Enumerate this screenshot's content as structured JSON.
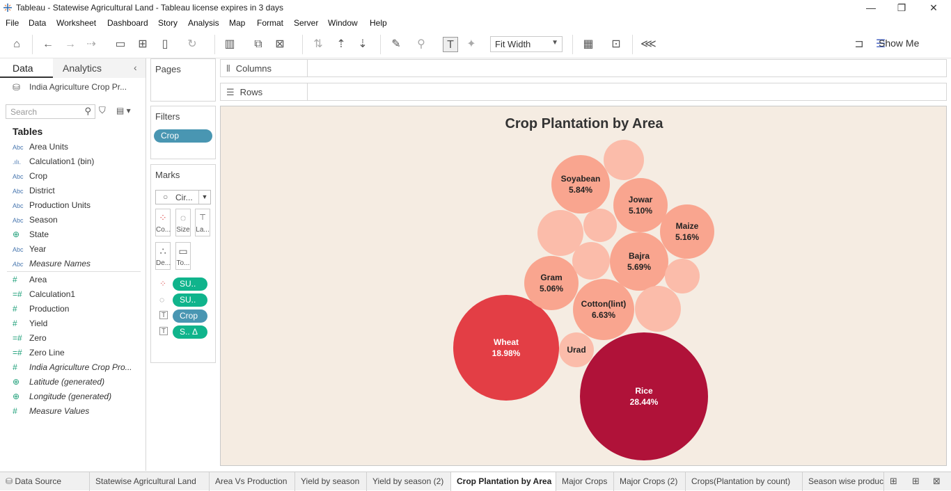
{
  "window": {
    "title": "Tableau - Statewise Agricultural Land - Tableau license expires in 3 days",
    "buttons": [
      "—",
      "❐",
      "✕"
    ]
  },
  "menu": [
    "File",
    "Data",
    "Worksheet",
    "Dashboard",
    "Story",
    "Analysis",
    "Map",
    "Format",
    "Server",
    "Window",
    "Help"
  ],
  "toolbar": {
    "fit": "Fit Width",
    "show_me": "Show Me"
  },
  "datapane": {
    "tabs": [
      "Data",
      "Analytics"
    ],
    "datasource": "India Agriculture Crop Pr...",
    "search_placeholder": "Search",
    "tables_heading": "Tables",
    "dimensions": [
      {
        "icon": "Abc",
        "type": "text",
        "name": "Area Units"
      },
      {
        "icon": ".ılı.",
        "type": "bin",
        "name": "Calculation1 (bin)"
      },
      {
        "icon": "Abc",
        "type": "text",
        "name": "Crop"
      },
      {
        "icon": "Abc",
        "type": "text",
        "name": "District"
      },
      {
        "icon": "Abc",
        "type": "text",
        "name": "Production Units"
      },
      {
        "icon": "Abc",
        "type": "text",
        "name": "Season"
      },
      {
        "icon": "⊕",
        "type": "geo",
        "name": "State"
      },
      {
        "icon": "Abc",
        "type": "text",
        "name": "Year"
      },
      {
        "icon": "Abc",
        "type": "text",
        "name": "Measure Names",
        "italic": true
      }
    ],
    "measures": [
      {
        "icon": "#",
        "name": "Area"
      },
      {
        "icon": "=#",
        "name": "Calculation1"
      },
      {
        "icon": "#",
        "name": "Production"
      },
      {
        "icon": "#",
        "name": "Yield"
      },
      {
        "icon": "=#",
        "name": "Zero"
      },
      {
        "icon": "=#",
        "name": "Zero Line"
      },
      {
        "icon": "#",
        "name": "India Agriculture Crop Pro...",
        "italic": true
      },
      {
        "icon": "⊕",
        "name": "Latitude (generated)",
        "italic": true
      },
      {
        "icon": "⊕",
        "name": "Longitude (generated)",
        "italic": true
      },
      {
        "icon": "#",
        "name": "Measure Values",
        "italic": true
      }
    ]
  },
  "cards": {
    "pages": "Pages",
    "filters": "Filters",
    "filter_pill": "Crop",
    "marks": "Marks",
    "mark_type": "Cir...",
    "mark_buttons": [
      "Co...",
      "Size",
      "La...",
      "De...",
      "To..."
    ],
    "mark_pills": [
      "SU..",
      "SU..",
      "Crop",
      "S.. Δ"
    ]
  },
  "shelves": {
    "columns": "Columns",
    "rows": "Rows"
  },
  "chart_data": {
    "type": "packed-bubble",
    "title": "Crop Plantation by Area",
    "bubbles": [
      {
        "label": "Rice",
        "value": "28.44%"
      },
      {
        "label": "Wheat",
        "value": "18.98%"
      },
      {
        "label": "Cotton(lint)",
        "value": "6.63%"
      },
      {
        "label": "Soyabean",
        "value": "5.84%"
      },
      {
        "label": "Bajra",
        "value": "5.69%"
      },
      {
        "label": "Maize",
        "value": "5.16%"
      },
      {
        "label": "Jowar",
        "value": "5.10%"
      },
      {
        "label": "Gram",
        "value": "5.06%"
      },
      {
        "label": "Urad",
        "value": ""
      },
      {
        "label": "",
        "value": ""
      },
      {
        "label": "",
        "value": ""
      },
      {
        "label": "",
        "value": ""
      },
      {
        "label": "",
        "value": ""
      },
      {
        "label": "",
        "value": ""
      },
      {
        "label": "",
        "value": ""
      }
    ],
    "colors": {
      "high": "#b01239",
      "mid": "#e33e45",
      "low": "#f9a58f",
      "faint": "#fbbcaa"
    }
  },
  "sheet_tabs": [
    "Data Source",
    "Statewise Agricultural Land",
    "Area Vs Production",
    "Yield by season",
    "Yield by season (2)",
    "Crop Plantation by Area",
    "Major Crops",
    "Major Crops (2)",
    "Crops(Plantation by count)",
    "Season wise produc"
  ],
  "active_sheet": "Crop Plantation by Area"
}
